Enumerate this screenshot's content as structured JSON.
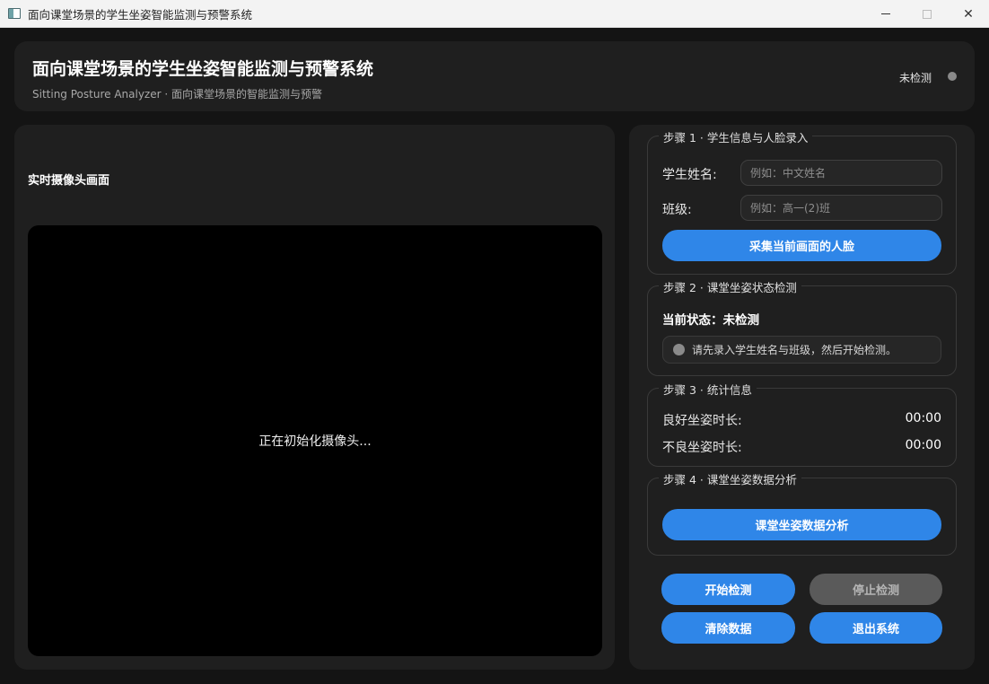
{
  "window": {
    "title": "面向课堂场景的学生坐姿智能监测与预警系统",
    "minimize": "—",
    "close": "✕"
  },
  "header": {
    "title": "面向课堂场景的学生坐姿智能监测与预警系统",
    "subtitle": "Sitting Posture Analyzer · 面向课堂场景的智能监测与预警",
    "status_label": "未检测",
    "status_color": "#8a8a8a"
  },
  "camera": {
    "title": "实时摄像头画面",
    "message": "正在初始化摄像头..."
  },
  "step1": {
    "title": "步骤 1 · 学生信息与人脸录入",
    "name_label": "学生姓名:",
    "name_value": "",
    "name_placeholder": "例如：中文姓名",
    "class_label": "班级:",
    "class_value": "",
    "class_placeholder": "例如：高一(2)班",
    "capture_button": "采集当前画面的人脸"
  },
  "step2": {
    "title": "步骤 2 · 课堂坐姿状态检测",
    "state_text": "当前状态：未检测",
    "hint": "请先录入学生姓名与班级，然后开始检测。"
  },
  "step3": {
    "title": "步骤 3 · 统计信息",
    "good_label": "良好坐姿时长:",
    "good_value": "00:00",
    "bad_label": "不良坐姿时长:",
    "bad_value": "00:00"
  },
  "step4": {
    "title": "步骤 4 · 课堂坐姿数据分析",
    "analyze_button": "课堂坐姿数据分析"
  },
  "controls": {
    "start": "开始检测",
    "stop": "停止检测",
    "clear": "清除数据",
    "exit": "退出系统"
  },
  "colors": {
    "accent": "#2f86e8",
    "disabled": "#5a5a5a",
    "background": "#141414",
    "panel": "#1f1f1f"
  }
}
